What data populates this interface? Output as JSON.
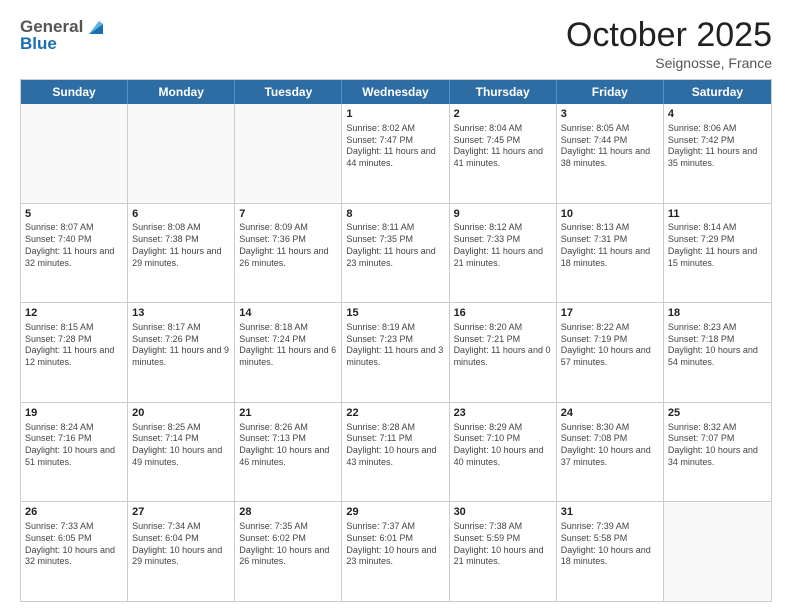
{
  "header": {
    "logo_line1": "General",
    "logo_line2": "Blue",
    "month": "October 2025",
    "location": "Seignosse, France"
  },
  "days_of_week": [
    "Sunday",
    "Monday",
    "Tuesday",
    "Wednesday",
    "Thursday",
    "Friday",
    "Saturday"
  ],
  "rows": [
    [
      {
        "day": "",
        "text": ""
      },
      {
        "day": "",
        "text": ""
      },
      {
        "day": "",
        "text": ""
      },
      {
        "day": "1",
        "text": "Sunrise: 8:02 AM\nSunset: 7:47 PM\nDaylight: 11 hours and 44 minutes."
      },
      {
        "day": "2",
        "text": "Sunrise: 8:04 AM\nSunset: 7:45 PM\nDaylight: 11 hours and 41 minutes."
      },
      {
        "day": "3",
        "text": "Sunrise: 8:05 AM\nSunset: 7:44 PM\nDaylight: 11 hours and 38 minutes."
      },
      {
        "day": "4",
        "text": "Sunrise: 8:06 AM\nSunset: 7:42 PM\nDaylight: 11 hours and 35 minutes."
      }
    ],
    [
      {
        "day": "5",
        "text": "Sunrise: 8:07 AM\nSunset: 7:40 PM\nDaylight: 11 hours and 32 minutes."
      },
      {
        "day": "6",
        "text": "Sunrise: 8:08 AM\nSunset: 7:38 PM\nDaylight: 11 hours and 29 minutes."
      },
      {
        "day": "7",
        "text": "Sunrise: 8:09 AM\nSunset: 7:36 PM\nDaylight: 11 hours and 26 minutes."
      },
      {
        "day": "8",
        "text": "Sunrise: 8:11 AM\nSunset: 7:35 PM\nDaylight: 11 hours and 23 minutes."
      },
      {
        "day": "9",
        "text": "Sunrise: 8:12 AM\nSunset: 7:33 PM\nDaylight: 11 hours and 21 minutes."
      },
      {
        "day": "10",
        "text": "Sunrise: 8:13 AM\nSunset: 7:31 PM\nDaylight: 11 hours and 18 minutes."
      },
      {
        "day": "11",
        "text": "Sunrise: 8:14 AM\nSunset: 7:29 PM\nDaylight: 11 hours and 15 minutes."
      }
    ],
    [
      {
        "day": "12",
        "text": "Sunrise: 8:15 AM\nSunset: 7:28 PM\nDaylight: 11 hours and 12 minutes."
      },
      {
        "day": "13",
        "text": "Sunrise: 8:17 AM\nSunset: 7:26 PM\nDaylight: 11 hours and 9 minutes."
      },
      {
        "day": "14",
        "text": "Sunrise: 8:18 AM\nSunset: 7:24 PM\nDaylight: 11 hours and 6 minutes."
      },
      {
        "day": "15",
        "text": "Sunrise: 8:19 AM\nSunset: 7:23 PM\nDaylight: 11 hours and 3 minutes."
      },
      {
        "day": "16",
        "text": "Sunrise: 8:20 AM\nSunset: 7:21 PM\nDaylight: 11 hours and 0 minutes."
      },
      {
        "day": "17",
        "text": "Sunrise: 8:22 AM\nSunset: 7:19 PM\nDaylight: 10 hours and 57 minutes."
      },
      {
        "day": "18",
        "text": "Sunrise: 8:23 AM\nSunset: 7:18 PM\nDaylight: 10 hours and 54 minutes."
      }
    ],
    [
      {
        "day": "19",
        "text": "Sunrise: 8:24 AM\nSunset: 7:16 PM\nDaylight: 10 hours and 51 minutes."
      },
      {
        "day": "20",
        "text": "Sunrise: 8:25 AM\nSunset: 7:14 PM\nDaylight: 10 hours and 49 minutes."
      },
      {
        "day": "21",
        "text": "Sunrise: 8:26 AM\nSunset: 7:13 PM\nDaylight: 10 hours and 46 minutes."
      },
      {
        "day": "22",
        "text": "Sunrise: 8:28 AM\nSunset: 7:11 PM\nDaylight: 10 hours and 43 minutes."
      },
      {
        "day": "23",
        "text": "Sunrise: 8:29 AM\nSunset: 7:10 PM\nDaylight: 10 hours and 40 minutes."
      },
      {
        "day": "24",
        "text": "Sunrise: 8:30 AM\nSunset: 7:08 PM\nDaylight: 10 hours and 37 minutes."
      },
      {
        "day": "25",
        "text": "Sunrise: 8:32 AM\nSunset: 7:07 PM\nDaylight: 10 hours and 34 minutes."
      }
    ],
    [
      {
        "day": "26",
        "text": "Sunrise: 7:33 AM\nSunset: 6:05 PM\nDaylight: 10 hours and 32 minutes."
      },
      {
        "day": "27",
        "text": "Sunrise: 7:34 AM\nSunset: 6:04 PM\nDaylight: 10 hours and 29 minutes."
      },
      {
        "day": "28",
        "text": "Sunrise: 7:35 AM\nSunset: 6:02 PM\nDaylight: 10 hours and 26 minutes."
      },
      {
        "day": "29",
        "text": "Sunrise: 7:37 AM\nSunset: 6:01 PM\nDaylight: 10 hours and 23 minutes."
      },
      {
        "day": "30",
        "text": "Sunrise: 7:38 AM\nSunset: 5:59 PM\nDaylight: 10 hours and 21 minutes."
      },
      {
        "day": "31",
        "text": "Sunrise: 7:39 AM\nSunset: 5:58 PM\nDaylight: 10 hours and 18 minutes."
      },
      {
        "day": "",
        "text": ""
      }
    ]
  ]
}
